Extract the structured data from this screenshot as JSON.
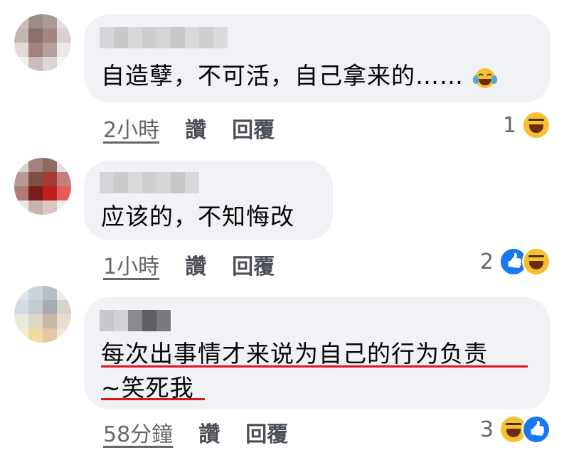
{
  "comments": [
    {
      "text_lines": [
        "自造孽，不可活，自己拿来的……"
      ],
      "time": "2小時",
      "like_label": "讚",
      "reply_label": "回覆",
      "reaction_count": "1",
      "reactions": [
        "haha-icon"
      ]
    },
    {
      "text_lines": [
        "应该的，不知悔改"
      ],
      "time": "1小時",
      "like_label": "讚",
      "reply_label": "回覆",
      "reaction_count": "2",
      "reactions": [
        "like-icon",
        "haha-icon"
      ]
    },
    {
      "text_lines": [
        "每次出事情才来说为自己的行为负责",
        "~笑死我"
      ],
      "time": "58分鐘",
      "like_label": "讚",
      "reply_label": "回覆",
      "reaction_count": "3",
      "reactions": [
        "haha-icon",
        "like-icon"
      ]
    }
  ],
  "colors": {
    "bubble": "#f0f2f5",
    "meta_text": "#65676b",
    "like_blue": "#1877f2",
    "haha_yellow": "#f7c12e",
    "annotation_red": "#e0141e"
  }
}
